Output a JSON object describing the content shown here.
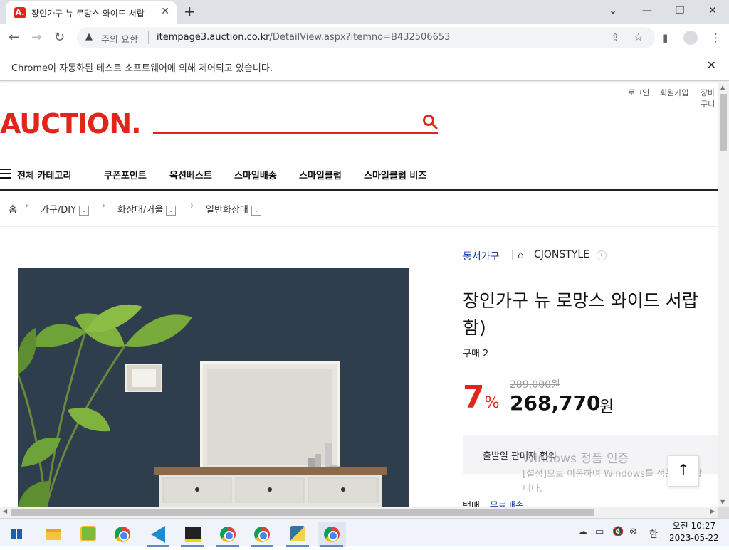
{
  "browser": {
    "tab_title": "장인가구 뉴 로망스 와이드 서랍",
    "tab_favicon": "A.",
    "security_label": "주의 요함",
    "url_host": "itempage3.auction.co.kr",
    "url_path": "/DetailView.aspx?itemno=B432506653",
    "automation_notice": "Chrome이 자동화된 테스트 소프트웨어에 의해 제어되고 있습니다."
  },
  "site": {
    "util_links": [
      "로그인",
      "회원가입",
      "장바구니"
    ],
    "logo": "AUCTION.",
    "menu_all": "전체 카테고리",
    "gnb": [
      "쿠폰포인트",
      "옥션베스트",
      "스마일배송",
      "스마일클럽",
      "스마일클럽 비즈"
    ]
  },
  "breadcrumb": {
    "home": "홈",
    "levels": [
      "가구/DIY",
      "화장대/거울",
      "일반화장대"
    ]
  },
  "product": {
    "brand": "동서가구",
    "store": "CJONSTYLE",
    "title": "장인가구 뉴 로망스 와이드 서랍 함)",
    "purchases": "구매 2",
    "discount": "7",
    "discount_unit": "%",
    "original_price": "289,000원",
    "price": "268,770",
    "price_unit": "원",
    "ship_info": "출발일 판매자 협의",
    "delivery_label": "택배",
    "delivery_value": "무료배송"
  },
  "overlay": {
    "watermark_title": "Windows 정품 인증",
    "watermark_sub": "[설정]으로 이동하여 Windows를 정품 인증합니다.",
    "top_button": "↑"
  },
  "taskbar": {
    "time": "오전 10:27",
    "date": "2023-05-22",
    "ime": "한"
  },
  "colors": {
    "brand_red": "#e1251b",
    "link_blue": "#1d3fa7"
  }
}
